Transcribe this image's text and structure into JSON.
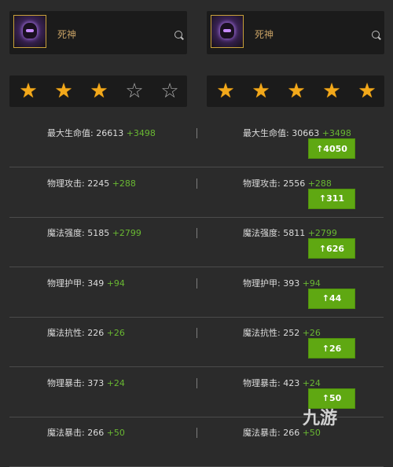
{
  "heroes": [
    {
      "name": "死神",
      "stars": 3
    },
    {
      "name": "死神",
      "stars": 5
    }
  ],
  "stats": [
    {
      "label": "最大生命值",
      "left": {
        "value": "26613",
        "bonus": "+3498"
      },
      "right": {
        "value": "30663",
        "bonus": "+3498"
      },
      "diff": "4050"
    },
    {
      "label": "物理攻击",
      "left": {
        "value": "2245",
        "bonus": "+288"
      },
      "right": {
        "value": "2556",
        "bonus": "+288"
      },
      "diff": "311"
    },
    {
      "label": "魔法强度",
      "left": {
        "value": "5185",
        "bonus": "+2799"
      },
      "right": {
        "value": "5811",
        "bonus": "+2799"
      },
      "diff": "626"
    },
    {
      "label": "物理护甲",
      "left": {
        "value": "349",
        "bonus": "+94"
      },
      "right": {
        "value": "393",
        "bonus": "+94"
      },
      "diff": "44"
    },
    {
      "label": "魔法抗性",
      "left": {
        "value": "226",
        "bonus": "+26"
      },
      "right": {
        "value": "252",
        "bonus": "+26"
      },
      "diff": "26"
    },
    {
      "label": "物理暴击",
      "left": {
        "value": "373",
        "bonus": "+24"
      },
      "right": {
        "value": "423",
        "bonus": "+24"
      },
      "diff": "50"
    },
    {
      "label": "魔法暴击",
      "left": {
        "value": "266",
        "bonus": "+50"
      },
      "right": {
        "value": "266",
        "bonus": "+50"
      },
      "diff": ""
    }
  ],
  "colors": {
    "accent": "#f3a91b",
    "bonus": "#69b832",
    "button": "#5fa812"
  },
  "watermark": "九游"
}
